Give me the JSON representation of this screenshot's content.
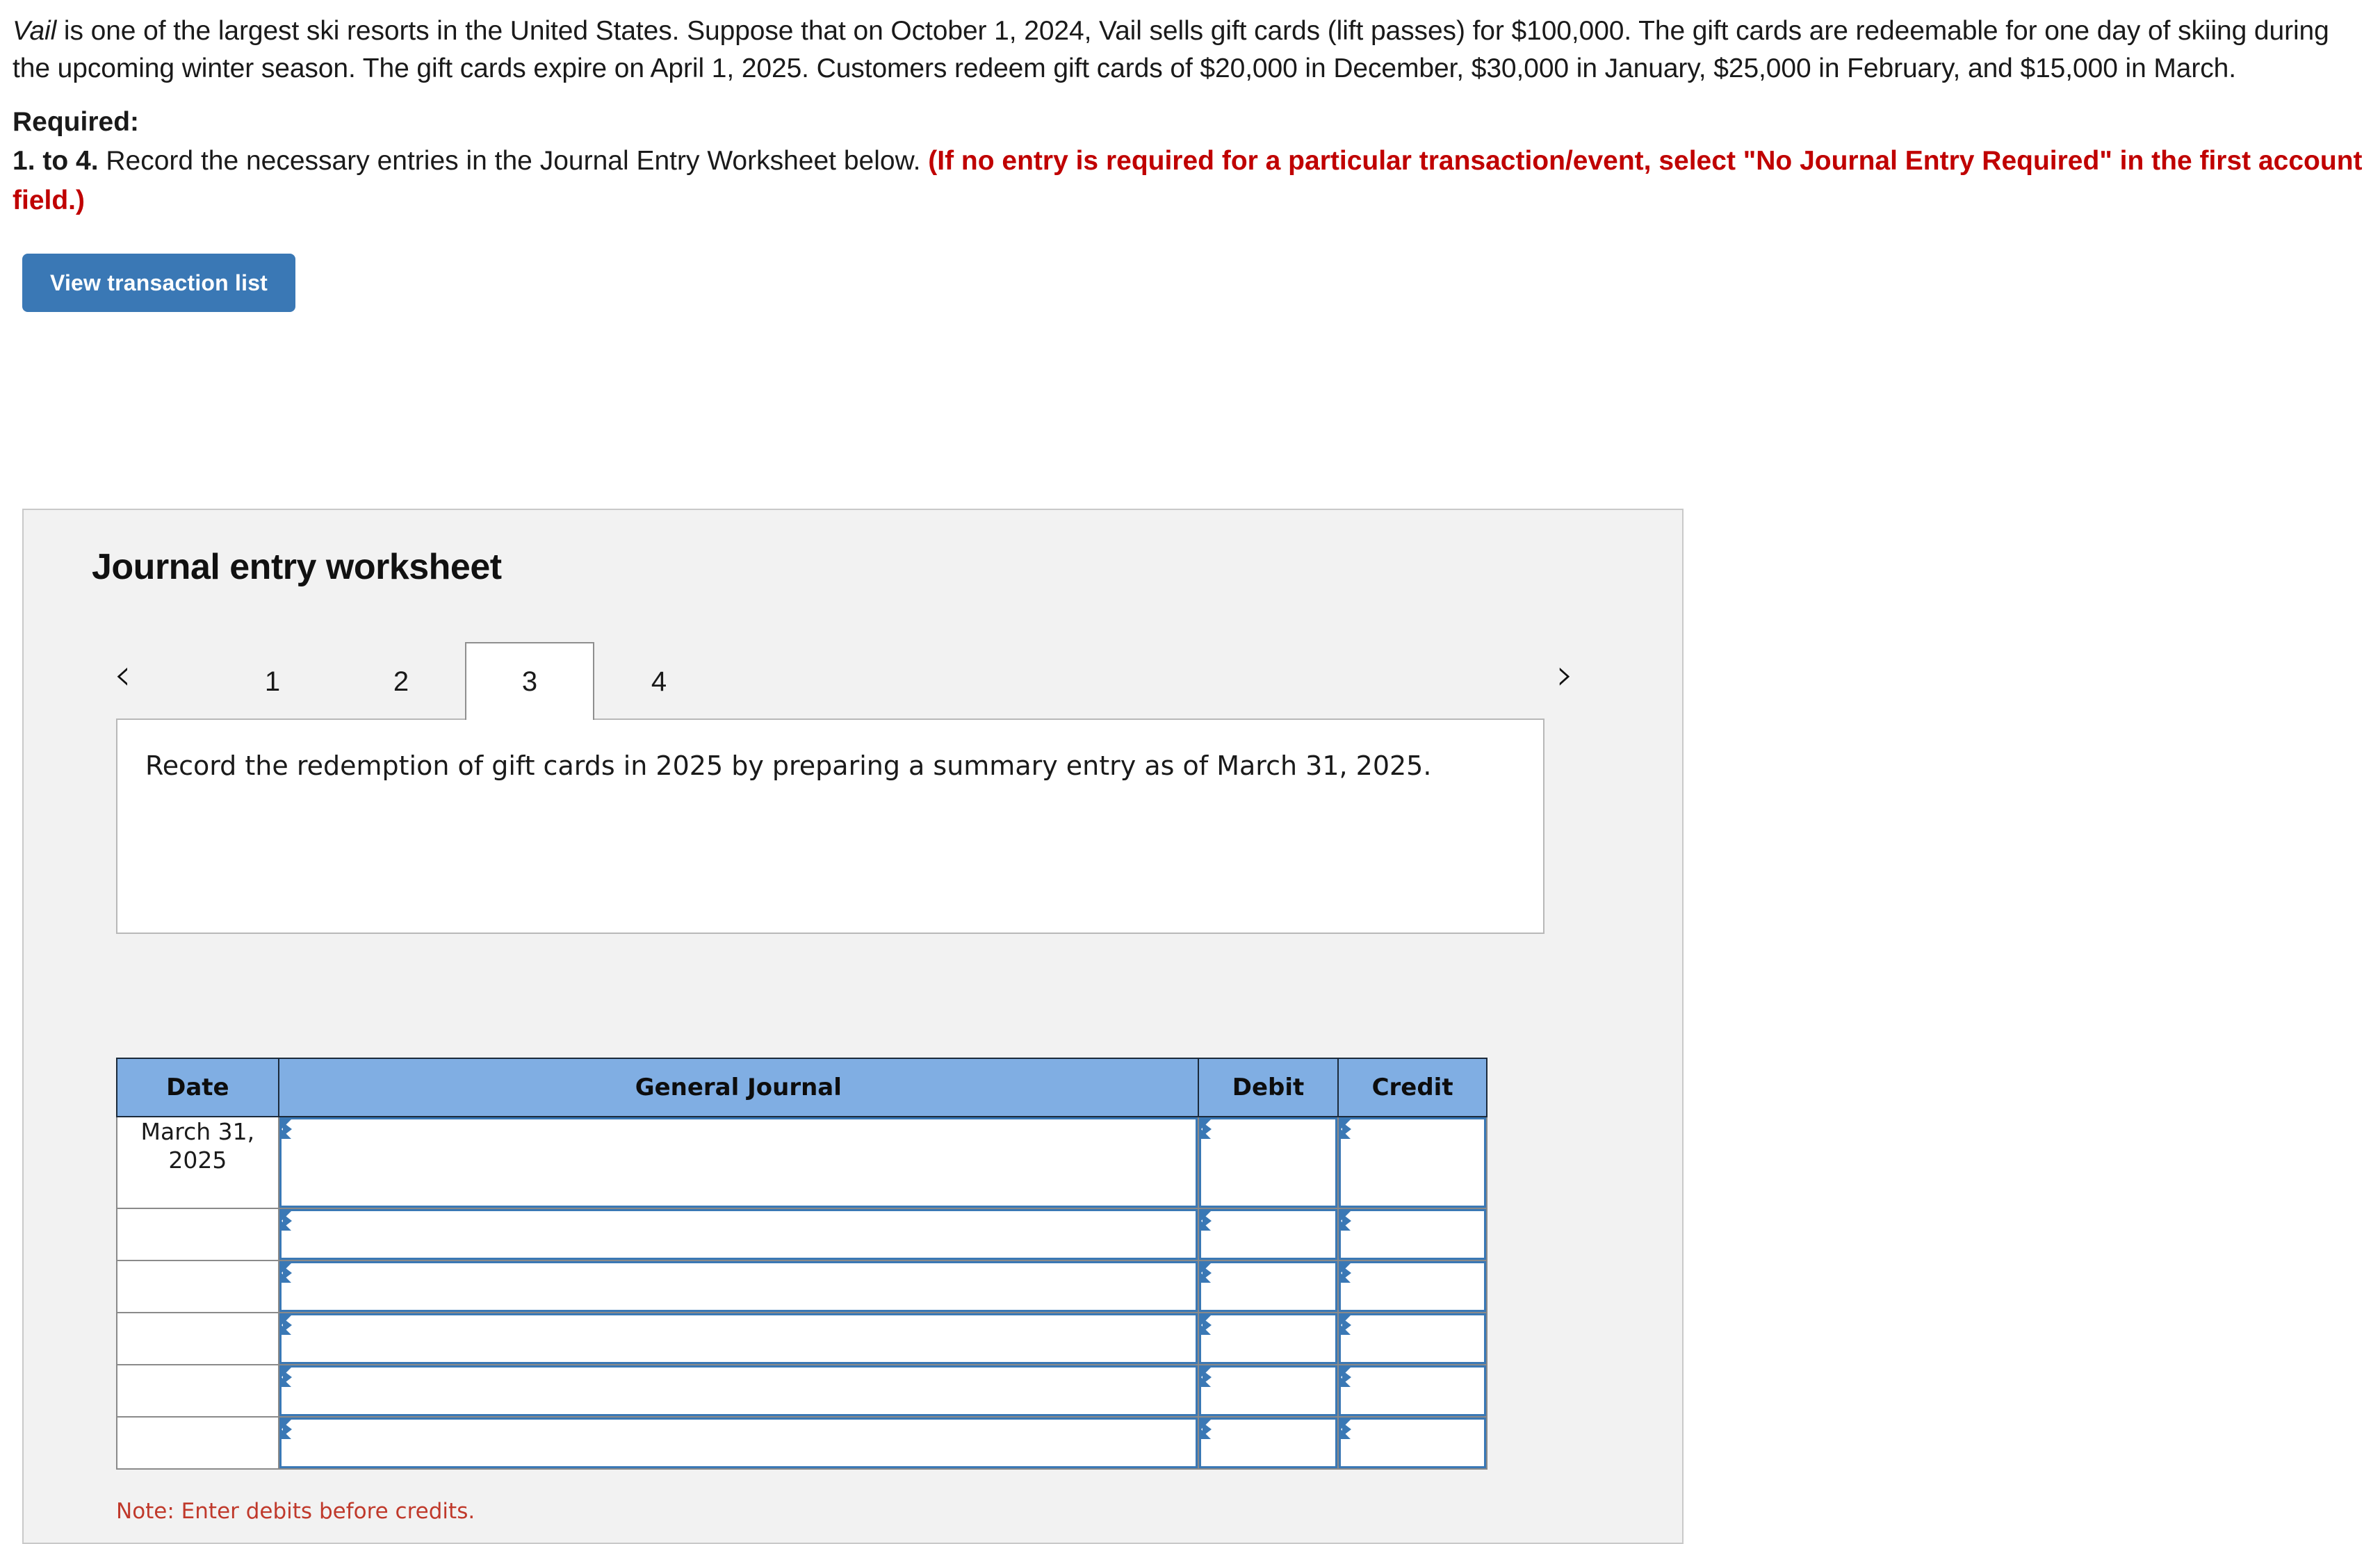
{
  "problem": {
    "company": "Vail",
    "line1_rest": " is one of the largest ski resorts in the United States. Suppose that on October 1, 2024, Vail sells gift cards (lift passes) for $100,000. The gift cards are redeemable for one day of skiing during the upcoming winter season. The gift cards expire on April 1, 2025. Customers redeem gift cards of $20,000 in December, $30,000 in January, $25,000 in February, and $15,000 in March."
  },
  "required": {
    "label": "Required:",
    "number": "1. to 4.",
    "text": " Record the necessary entries in the Journal Entry Worksheet below. ",
    "red_text": "(If no entry is required for a particular transaction/event, select \"No Journal Entry Required\" in the first account field.)"
  },
  "buttons": {
    "view_transaction_list": "View transaction list"
  },
  "worksheet": {
    "title": "Journal entry worksheet",
    "prev_arrow": "‹",
    "next_arrow": "›",
    "tabs": [
      {
        "label": "1",
        "active": false
      },
      {
        "label": "2",
        "active": false
      },
      {
        "label": "3",
        "active": true
      },
      {
        "label": "4",
        "active": false
      }
    ],
    "instruction": "Record the redemption of gift cards in 2025 by preparing a summary entry as of March 31, 2025.",
    "note": "Note: Enter debits before credits."
  },
  "journal_table": {
    "headers": [
      "Date",
      "General Journal",
      "Debit",
      "Credit"
    ],
    "rows": [
      {
        "date": "March 31, 2025",
        "general_journal": "",
        "debit": "",
        "credit": ""
      },
      {
        "date": "",
        "general_journal": "",
        "debit": "",
        "credit": ""
      },
      {
        "date": "",
        "general_journal": "",
        "debit": "",
        "credit": ""
      },
      {
        "date": "",
        "general_journal": "",
        "debit": "",
        "credit": ""
      },
      {
        "date": "",
        "general_journal": "",
        "debit": "",
        "credit": ""
      },
      {
        "date": "",
        "general_journal": "",
        "debit": "",
        "credit": ""
      }
    ]
  },
  "colors": {
    "button_blue": "#3a78b5",
    "header_blue": "#80aee3",
    "red": "#c00000",
    "note_red": "#c0392b",
    "panel_gray": "#f2f2f2"
  }
}
